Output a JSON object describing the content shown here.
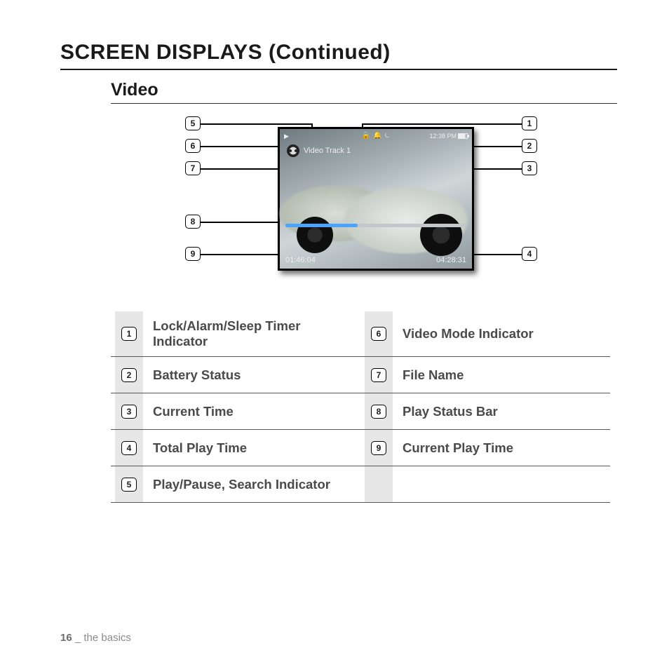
{
  "page": {
    "title": "SCREEN DISPLAYS (Continued)",
    "section": "Video",
    "footer_page": "16",
    "footer_sep": " _ ",
    "footer_text": "the basics"
  },
  "screen": {
    "play_state_glyph": "▶",
    "lock_glyph": "🔒",
    "alarm_glyph": "🔔",
    "sleep_glyph": "⏾",
    "clock_time": "12:38 PM",
    "file_name": "Video Track 1",
    "current_play_time": "01:46:04",
    "total_play_time": "04:28:31",
    "progress_pct": 40
  },
  "callouts_left": [
    {
      "n": "5"
    },
    {
      "n": "6"
    },
    {
      "n": "7"
    },
    {
      "n": "8"
    },
    {
      "n": "9"
    }
  ],
  "callouts_right": [
    {
      "n": "1"
    },
    {
      "n": "2"
    },
    {
      "n": "3"
    },
    {
      "n": "4"
    }
  ],
  "legend_left": [
    {
      "n": "1",
      "label": "Lock/Alarm/Sleep Timer Indicator"
    },
    {
      "n": "2",
      "label": "Battery Status"
    },
    {
      "n": "3",
      "label": "Current Time"
    },
    {
      "n": "4",
      "label": "Total Play Time"
    },
    {
      "n": "5",
      "label": "Play/Pause, Search Indicator"
    }
  ],
  "legend_right": [
    {
      "n": "6",
      "label": "Video Mode Indicator"
    },
    {
      "n": "7",
      "label": "File Name"
    },
    {
      "n": "8",
      "label": "Play Status Bar"
    },
    {
      "n": "9",
      "label": "Current Play Time"
    }
  ]
}
